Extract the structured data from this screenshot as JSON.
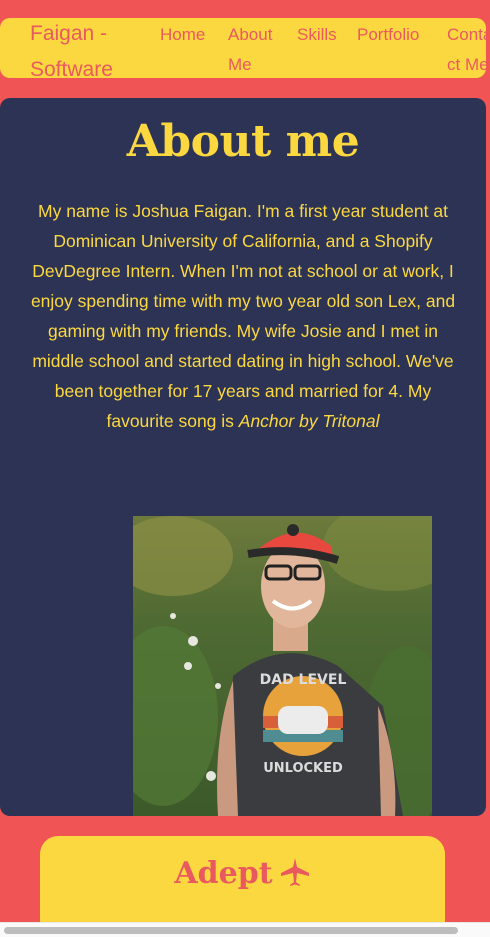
{
  "nav": {
    "brand": "Faigan - Software Developer",
    "links": [
      "Home",
      "About Me",
      "Skills",
      "Portfolio",
      "Contact Me"
    ]
  },
  "about": {
    "title": "About me",
    "paragraph": "My name is Joshua Faigan. I'm a first year student at Dominican University of California, and a Shopify DevDegree Intern. When I'm not at school or at work, I enjoy spending time with my two year old son Lex, and gaming with my friends. My wife Josie and I met in middle school and started dating in high school. We've been together for 17 years and married for 4. My favourite song is ",
    "song": "Anchor by Tritonal",
    "photo_shirt_text": [
      "DAD LEVEL",
      "UNLOCKED"
    ]
  },
  "skills": {
    "title": "Adept",
    "icon": "airplane-icon"
  },
  "colors": {
    "background": "#f05454",
    "accent_yellow": "#fcd840",
    "card_navy": "#2c3354",
    "brand_red": "#e85a5e"
  }
}
